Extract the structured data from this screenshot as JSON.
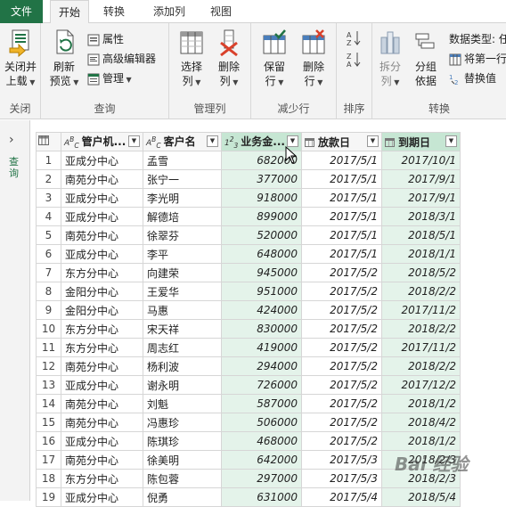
{
  "tabs": [
    "文件",
    "开始",
    "转换",
    "添加列",
    "视图"
  ],
  "ribbon": {
    "close_group": {
      "label": "关闭",
      "button": "关闭并",
      "button2": "上载"
    },
    "query_group": {
      "label": "查询",
      "refresh": "刷新",
      "refresh2": "预览",
      "properties": "属性",
      "advanced_editor": "高级编辑器",
      "manage": "管理"
    },
    "manage_cols_group": {
      "label": "管理列",
      "choose": "选择",
      "choose2": "列",
      "remove": "删除",
      "remove2": "列"
    },
    "reduce_rows_group": {
      "label": "减少行",
      "keep": "保留",
      "keep2": "行",
      "remove": "删除",
      "remove2": "行"
    },
    "sort_group": {
      "label": "排序"
    },
    "transform_group": {
      "label": "转换",
      "split": "拆分",
      "split2": "列",
      "group": "分组",
      "group2": "依据",
      "data_type": "数据类型: 任",
      "first_row": "将第一行",
      "replace": "替换值"
    }
  },
  "leftnav": {
    "label": "查询"
  },
  "columns": [
    "管户机...",
    "客户名",
    "业务金...",
    "放款日",
    "到期日"
  ],
  "rows": [
    [
      "1",
      "亚成分中心",
      "孟雪",
      "682000",
      "2017/5/1",
      "2017/10/1"
    ],
    [
      "2",
      "南苑分中心",
      "张宁一",
      "377000",
      "2017/5/1",
      "2017/9/1"
    ],
    [
      "3",
      "亚成分中心",
      "李光明",
      "918000",
      "2017/5/1",
      "2017/9/1"
    ],
    [
      "4",
      "亚成分中心",
      "解德培",
      "899000",
      "2017/5/1",
      "2018/3/1"
    ],
    [
      "5",
      "南苑分中心",
      "徐翠芬",
      "520000",
      "2017/5/1",
      "2018/5/1"
    ],
    [
      "6",
      "亚成分中心",
      "李平",
      "648000",
      "2017/5/1",
      "2018/1/1"
    ],
    [
      "7",
      "东方分中心",
      "向建荣",
      "945000",
      "2017/5/2",
      "2018/5/2"
    ],
    [
      "8",
      "金阳分中心",
      "王爱华",
      "951000",
      "2017/5/2",
      "2018/2/2"
    ],
    [
      "9",
      "金阳分中心",
      "马惠",
      "424000",
      "2017/5/2",
      "2017/11/2"
    ],
    [
      "10",
      "东方分中心",
      "宋天祥",
      "830000",
      "2017/5/2",
      "2018/2/2"
    ],
    [
      "11",
      "东方分中心",
      "周志红",
      "419000",
      "2017/5/2",
      "2017/11/2"
    ],
    [
      "12",
      "南苑分中心",
      "杨利波",
      "294000",
      "2017/5/2",
      "2018/2/2"
    ],
    [
      "13",
      "亚成分中心",
      "谢永明",
      "726000",
      "2017/5/2",
      "2017/12/2"
    ],
    [
      "14",
      "南苑分中心",
      "刘魁",
      "587000",
      "2017/5/2",
      "2018/1/2"
    ],
    [
      "15",
      "南苑分中心",
      "冯惠珍",
      "506000",
      "2017/5/2",
      "2018/4/2"
    ],
    [
      "16",
      "亚成分中心",
      "陈琪珍",
      "468000",
      "2017/5/2",
      "2018/1/2"
    ],
    [
      "17",
      "南苑分中心",
      "徐美明",
      "642000",
      "2017/5/3",
      "2018/2/3"
    ],
    [
      "18",
      "东方分中心",
      "陈包蓉",
      "297000",
      "2017/5/3",
      "2018/2/3"
    ],
    [
      "19",
      "亚成分中心",
      "倪勇",
      "631000",
      "2017/5/4",
      "2018/5/4"
    ]
  ],
  "watermark": "Bai 经验",
  "colors": {
    "excel_green": "#217346",
    "selected_col": "#c6e6d3",
    "selected_cell": "#e4f3ea"
  }
}
